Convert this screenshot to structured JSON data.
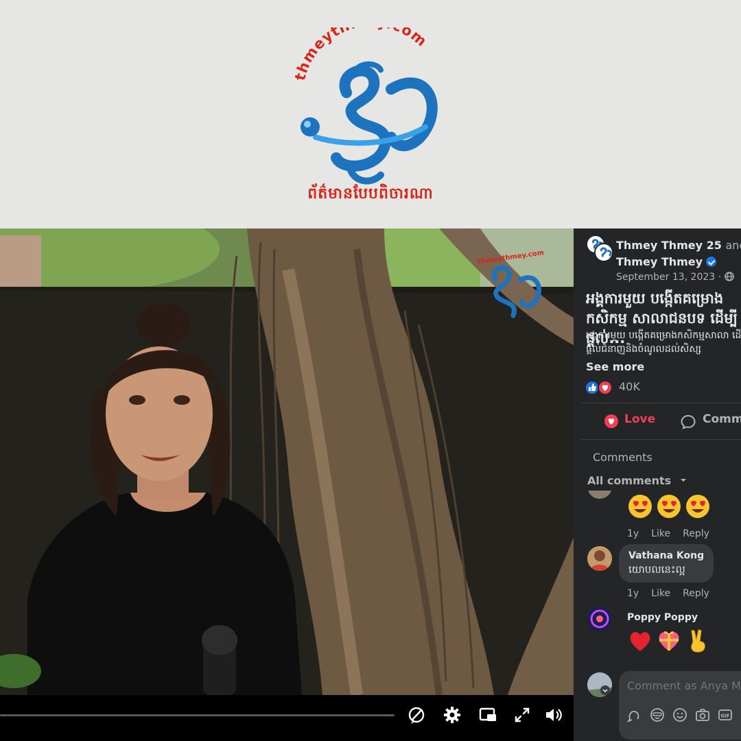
{
  "brand": {
    "logo_text": "thmeythmey.com",
    "tagline": "ព័ត៌មានបែបពិចារណា",
    "watermark_text": "thmeythmey.com"
  },
  "video_controls": {
    "progress": 0,
    "icons": [
      "no-captions-icon",
      "settings-icon",
      "picture-in-picture-icon",
      "fullscreen-icon",
      "volume-icon"
    ]
  },
  "post": {
    "poster_primary": "Thmey Thmey 25",
    "and_word": "and",
    "poster_secondary": "Thmey Thmey",
    "date": "September 13, 2023 ·",
    "title": "អង្គការមួយ បង្កើតគម្រោងកសិកម្ម សាលាជនបទ ដើម្បីផ្តល់...",
    "body": "អង្គការមួយ បង្កើតគម្រោងកសិកម្មសាលា ដើម្បីផ្តល់ជំនាញនិងចំណូលដល់សិស្ស",
    "see_more": "See more",
    "reaction_count": "40K",
    "love_label": "Love",
    "comment_label": "Comment"
  },
  "comments": {
    "heading": "Comments",
    "filter_label": "All comments",
    "items": [
      {
        "name": "",
        "text": "",
        "emoji": [
          "heart-eyes-emoji",
          "heart-eyes-emoji",
          "heart-eyes-emoji"
        ],
        "time": "1y",
        "like": "Like",
        "reply": "Reply"
      },
      {
        "name": "Vathana Kong",
        "text": "យោបលនេះល្អ",
        "time": "1y",
        "like": "Like",
        "reply": "Reply"
      },
      {
        "name": "Poppy Poppy",
        "text": "",
        "emoji": [
          "red-heart-emoji",
          "gift-heart-emoji",
          "victory-hand-emoji"
        ]
      }
    ],
    "input_placeholder": "Comment as Anya Meas"
  },
  "colors": {
    "accent_blue": "#1b74e4",
    "love_red": "#f33e58",
    "brand_red": "#d8261b",
    "brand_blue": "#1e73be"
  }
}
